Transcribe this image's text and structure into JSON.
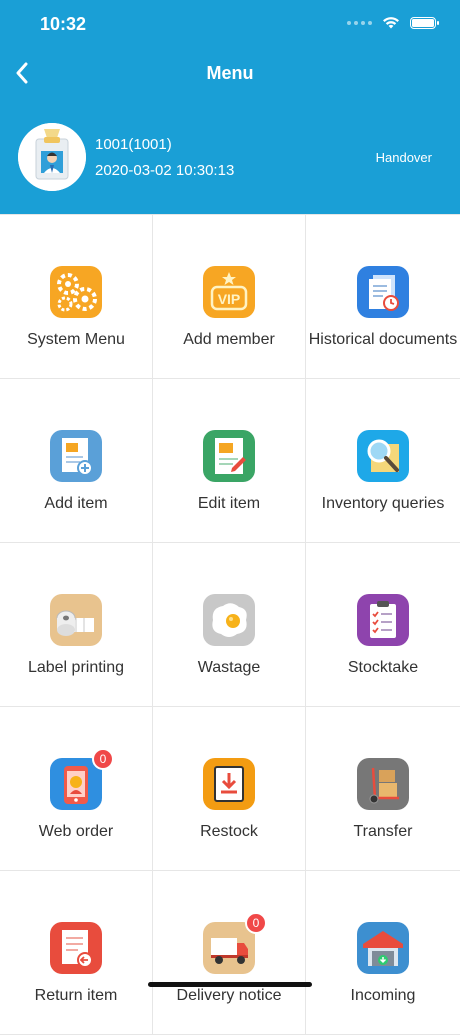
{
  "status": {
    "time": "10:32"
  },
  "nav": {
    "title": "Menu",
    "back_icon": "chevron-left-icon"
  },
  "user": {
    "id": "1001(1001)",
    "datetime": "2020-03-02 10:30:13",
    "handover_label": "Handover"
  },
  "colors": {
    "header": "#1a9fd6",
    "badge": "#f04848"
  },
  "menu": [
    {
      "label": "System Menu",
      "icon": "gears-icon"
    },
    {
      "label": "Add member",
      "icon": "vip-icon"
    },
    {
      "label": "Historical documents",
      "icon": "documents-clock-icon"
    },
    {
      "label": "Add item",
      "icon": "document-add-icon"
    },
    {
      "label": "Edit item",
      "icon": "document-edit-icon"
    },
    {
      "label": "Inventory queries",
      "icon": "magnifier-icon"
    },
    {
      "label": "Label printing",
      "icon": "label-roll-icon"
    },
    {
      "label": "Wastage",
      "icon": "fried-egg-icon"
    },
    {
      "label": "Stocktake",
      "icon": "clipboard-check-icon"
    },
    {
      "label": "Web order",
      "icon": "phone-order-icon",
      "badge": "0"
    },
    {
      "label": "Restock",
      "icon": "download-box-icon"
    },
    {
      "label": "Transfer",
      "icon": "hand-truck-icon"
    },
    {
      "label": "Return item",
      "icon": "document-return-icon"
    },
    {
      "label": "Delivery notice",
      "icon": "delivery-truck-icon",
      "badge": "0"
    },
    {
      "label": "Incoming",
      "icon": "warehouse-icon"
    }
  ]
}
